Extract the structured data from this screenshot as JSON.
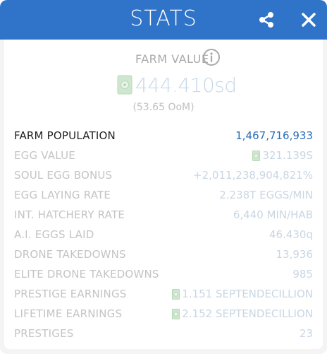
{
  "header": {
    "title": "STATS",
    "share_icon": "share-icon",
    "close_icon": "close-icon",
    "color": "#2f74c8"
  },
  "farm_value": {
    "label": "FARM VALUE",
    "info_icon": "info-icon",
    "amount": "444.410sd",
    "sub": "(53.65 OoM)",
    "currency_icon": "money-icon"
  },
  "stats": [
    {
      "label": "FARM POPULATION",
      "value": "1,467,716,933",
      "money": false,
      "primary": true
    },
    {
      "label": "EGG VALUE",
      "value": "321.139S",
      "money": true,
      "primary": false
    },
    {
      "label": "SOUL EGG BONUS",
      "value": "+2,011,238,904,821%",
      "money": false,
      "primary": false
    },
    {
      "label": "EGG LAYING RATE",
      "value": "2.238T EGGS/MIN",
      "money": false,
      "primary": false
    },
    {
      "label": "INT. HATCHERY RATE",
      "value": "6,440 MIN/HAB",
      "money": false,
      "primary": false
    },
    {
      "label": "A.I. EGGS LAID",
      "value": "46.430q",
      "money": false,
      "primary": false
    },
    {
      "label": "DRONE TAKEDOWNS",
      "value": "13,936",
      "money": false,
      "primary": false
    },
    {
      "label": "ELITE DRONE TAKEDOWNS",
      "value": "985",
      "money": false,
      "primary": false
    },
    {
      "label": "PRESTIGE EARNINGS",
      "value": "1.151 SEPTENDECILLION",
      "money": true,
      "primary": false
    },
    {
      "label": "LIFETIME EARNINGS",
      "value": "2.152 SEPTENDECILLION",
      "money": true,
      "primary": false
    },
    {
      "label": "PRESTIGES",
      "value": "23",
      "money": false,
      "primary": false
    }
  ]
}
